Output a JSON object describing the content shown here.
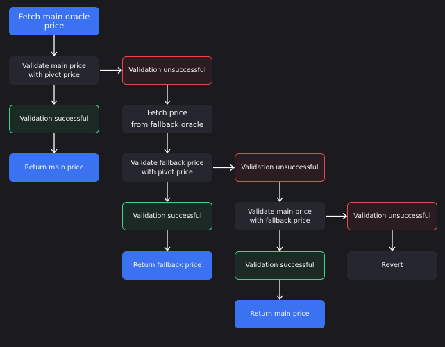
{
  "colors": {
    "background": "#1b1b1f",
    "primary": "#3a72f2",
    "process": "#26262e",
    "failure_border": "#e5484d",
    "success_border": "#3dd68c",
    "arrow": "#ffffff"
  },
  "nodes": [
    {
      "id": "fetch-main",
      "type": "start",
      "label": "Fetch main oracle price"
    },
    {
      "id": "validate-main-pivot",
      "type": "process",
      "label": "Validate main price\nwith pivot price"
    },
    {
      "id": "fail-1",
      "type": "fail",
      "label": "Validation unsuccessful"
    },
    {
      "id": "success-1",
      "type": "success",
      "label": "Validation successful"
    },
    {
      "id": "fetch-fallback",
      "type": "process",
      "label": "Fetch price\nfrom fallback oracle"
    },
    {
      "id": "return-main-1",
      "type": "result",
      "label": "Return main price"
    },
    {
      "id": "validate-fallback-pivot",
      "type": "process",
      "label": "Validate fallback price\nwith pivot price"
    },
    {
      "id": "fail-2",
      "type": "fail",
      "label": "Validation unsuccessful"
    },
    {
      "id": "success-2",
      "type": "success",
      "label": "Validation successful"
    },
    {
      "id": "validate-main-fallback",
      "type": "process",
      "label": "Validate main price\nwith fallback price"
    },
    {
      "id": "fail-3",
      "type": "fail",
      "label": "Validation unsuccessful"
    },
    {
      "id": "return-fallback",
      "type": "result",
      "label": "Return fallback price"
    },
    {
      "id": "success-3",
      "type": "success",
      "label": "Validation successful"
    },
    {
      "id": "revert",
      "type": "process",
      "label": "Revert"
    },
    {
      "id": "return-main-2",
      "type": "result",
      "label": "Return main price"
    }
  ],
  "edges": [
    [
      "fetch-main",
      "validate-main-pivot"
    ],
    [
      "validate-main-pivot",
      "fail-1"
    ],
    [
      "validate-main-pivot",
      "success-1"
    ],
    [
      "success-1",
      "return-main-1"
    ],
    [
      "fail-1",
      "fetch-fallback"
    ],
    [
      "fetch-fallback",
      "validate-fallback-pivot"
    ],
    [
      "validate-fallback-pivot",
      "fail-2"
    ],
    [
      "validate-fallback-pivot",
      "success-2"
    ],
    [
      "success-2",
      "return-fallback"
    ],
    [
      "fail-2",
      "validate-main-fallback"
    ],
    [
      "validate-main-fallback",
      "fail-3"
    ],
    [
      "validate-main-fallback",
      "success-3"
    ],
    [
      "success-3",
      "return-main-2"
    ],
    [
      "fail-3",
      "revert"
    ]
  ]
}
